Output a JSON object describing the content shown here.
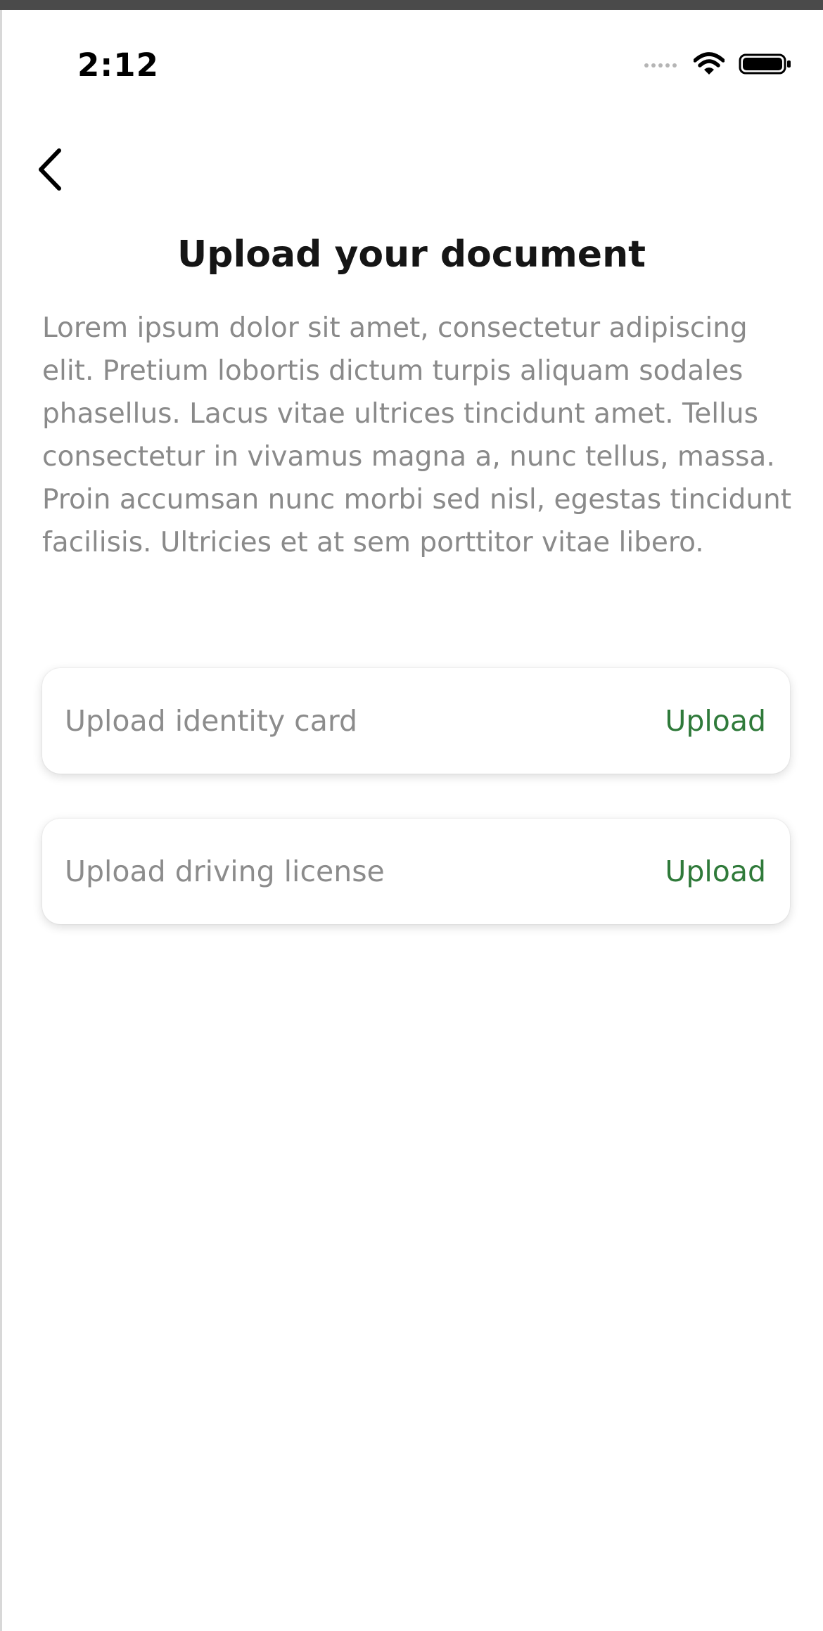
{
  "status_bar": {
    "time": "2:12",
    "signal_icon": "cellular-dots-icon",
    "wifi_icon": "wifi-icon",
    "battery_icon": "battery-icon"
  },
  "header": {
    "back_icon": "chevron-left-icon",
    "title": "Upload your document"
  },
  "description": "Lorem ipsum dolor sit amet, consectetur adipiscing elit. Pretium lobortis dictum turpis aliquam sodales phasellus. Lacus vitae ultrices tincidunt amet. Tellus consectetur in vivamus magna a, nunc tellus, massa. Proin accumsan nunc morbi sed nisl, egestas tincidunt facilisis. Ultricies et at sem porttitor vitae libero.",
  "uploads": [
    {
      "label": "Upload identity card",
      "action": "Upload"
    },
    {
      "label": "Upload driving license",
      "action": "Upload"
    }
  ],
  "colors": {
    "accent": "#2f7a3a",
    "title": "#151515",
    "body_text": "#8a8a8a"
  }
}
